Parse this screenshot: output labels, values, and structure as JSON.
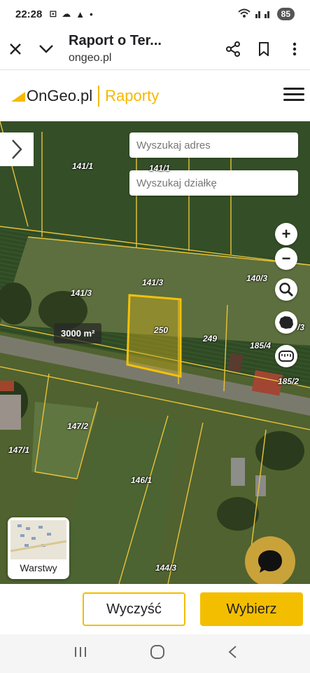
{
  "status_bar": {
    "time": "22:28",
    "battery": "85"
  },
  "toolbar": {
    "title": "Raport o Ter...",
    "url": "ongeo.pl"
  },
  "site": {
    "logo": "OnGeo.pl",
    "section": "Raporty"
  },
  "search": {
    "address_placeholder": "Wyszukaj adres",
    "parcel_placeholder": "Wyszukaj działkę"
  },
  "map": {
    "area_label": "3000 m²",
    "parcels": [
      "141/1",
      "141/1",
      "141/3",
      "141/3",
      "140/3",
      "250",
      "249",
      "185/4",
      "/3",
      "185/2",
      "147/2",
      "147/1",
      "146/1",
      "144/3"
    ],
    "controls": {
      "zoom_in": "+",
      "zoom_out": "−"
    },
    "layers_label": "Warstwy"
  },
  "actions": {
    "clear": "Wyczyść",
    "select": "Wybierz"
  },
  "colors": {
    "accent": "#f4be00",
    "parcel_line": "#e8c23a"
  }
}
